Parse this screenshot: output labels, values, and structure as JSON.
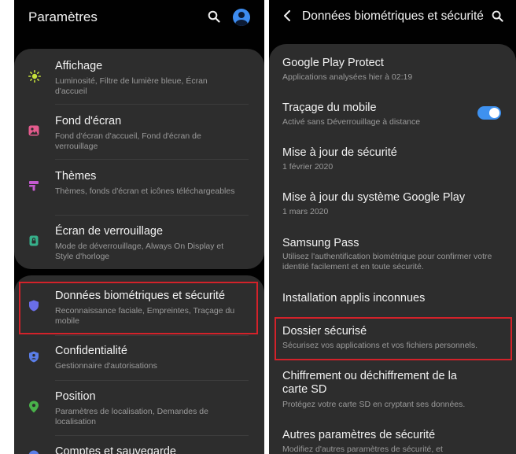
{
  "left": {
    "header": {
      "title": "Paramètres",
      "icons": [
        "search-icon",
        "account-icon"
      ]
    },
    "items": [
      {
        "title": "Affichage",
        "subtitle": "Luminosité, Filtre de lumière bleue, Écran d'accueil",
        "icon": "sun-icon",
        "icon_color": "#c7e23b"
      },
      {
        "title": "Fond d'écran",
        "subtitle": "Fond d'écran d'accueil, Fond d'écran de verrouillage",
        "icon": "image-icon",
        "icon_color": "#e45b8d"
      },
      {
        "title": "Thèmes",
        "subtitle": "Thèmes, fonds d'écran et icônes téléchargeables",
        "icon": "brush-icon",
        "icon_color": "#c45ad0"
      },
      {
        "title": "Écran de verrouillage",
        "subtitle": "Mode de déverrouillage, Always On Display et Style d'horloge",
        "icon": "lock-icon",
        "icon_color": "#36b08a"
      },
      {
        "title": "Données biométriques et sécurité",
        "subtitle": "Reconnaissance faciale, Empreintes, Traçage du mobile",
        "icon": "shield-icon",
        "icon_color": "#6a6ee8"
      },
      {
        "title": "Confidentialité",
        "subtitle": "Gestionnaire d'autorisations",
        "icon": "privacy-icon",
        "icon_color": "#5a7ee8"
      },
      {
        "title": "Position",
        "subtitle": "Paramètres de localisation, Demandes de localisation",
        "icon": "location-icon",
        "icon_color": "#49b24a"
      },
      {
        "title": "Comptes et sauvegarde",
        "subtitle": "",
        "icon": "account-key-icon",
        "icon_color": "#5a7ee8"
      }
    ]
  },
  "right": {
    "header": {
      "title": "Données biométriques et sécurité",
      "icons": [
        "back-icon",
        "search-icon"
      ]
    },
    "items": [
      {
        "title": "Google Play Protect",
        "subtitle": "Applications analysées hier à 02:19"
      },
      {
        "title": "Traçage du mobile",
        "subtitle": "Activé sans Déverrouillage à distance",
        "toggle": "on"
      },
      {
        "title": "Mise à jour de sécurité",
        "subtitle": "1 février 2020"
      },
      {
        "title": "Mise à jour du système Google Play",
        "subtitle": "1 mars 2020"
      },
      {
        "title": "Samsung Pass",
        "subtitle": "Utilisez l'authentification biométrique pour confirmer votre identité facilement et en toute sécurité."
      },
      {
        "title": "Installation applis inconnues",
        "subtitle": ""
      },
      {
        "title": "Dossier sécurisé",
        "subtitle": "Sécurisez vos applications et vos fichiers personnels."
      },
      {
        "title": "Chiffrement ou déchiffrement de la carte SD",
        "subtitle": "Protégez votre carte SD en cryptant ses données."
      },
      {
        "title": "Autres paramètres de sécurité",
        "subtitle": "Modifiez d'autres paramètres de sécurité, et"
      }
    ]
  },
  "colors": {
    "highlight": "#d3222a",
    "accent": "#3e91ef",
    "background": "#010101",
    "card": "#2d2d2d"
  }
}
